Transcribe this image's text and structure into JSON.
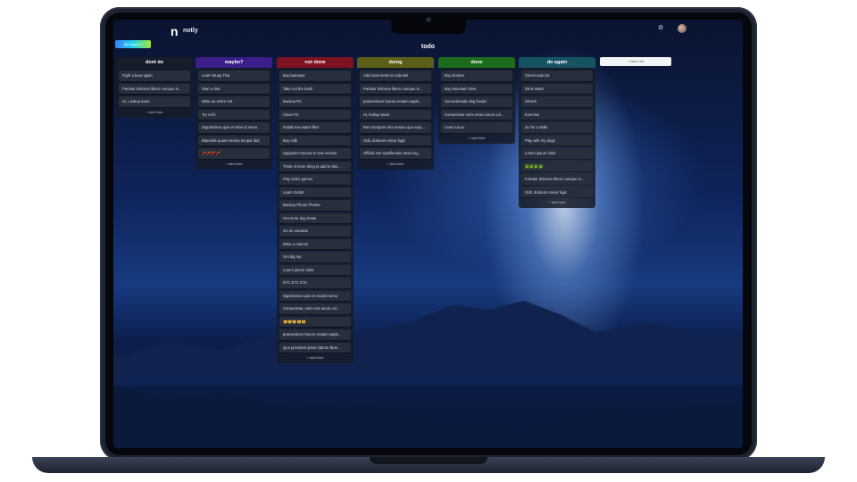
{
  "app": {
    "name": "notly",
    "logo": "n"
  },
  "header": {
    "settings_icon": "sliders-icon",
    "board_button": "My Board 1",
    "board_title": "todo"
  },
  "add_list_label": "+ Add List",
  "columns": [
    {
      "title": "dont do",
      "color": "#161c28",
      "cards": [
        "Fight a bear again",
        "Pariatur dolorum libero cumque is...",
        "Hi, Lookup team"
      ],
      "add_note": "+ Add Note"
    },
    {
      "title": "maybe?",
      "color": "#3b1e8a",
      "cards": [
        "Learn Muay Thai",
        "Start a diet",
        "Write an entire OS",
        "Try Arch",
        "Dignissimos quis et vitae id nemo",
        "Blanditiis quasi minima tempor ibid",
        "🧨🧨🧨🧨"
      ],
      "add_note": "+ Add Note"
    },
    {
      "title": "not done",
      "color": "#7d1220",
      "cards": [
        "Buy bananas",
        "Take out the trash",
        "Backup PC",
        "Clean PC",
        "Install new water filter",
        "Buy milk",
        "Upgrade Fusuma to new version",
        "Think of more thing to add to this ...",
        "Play video games",
        "Learn Godot",
        "Backup Phone Photos",
        "Get more dog treats",
        "Go on vacation",
        "Write a memoir",
        "Get dig ray",
        "Lorem ipsum dolor",
        "ETC ETC ETC",
        "Dignissimos quis et eiusrid nemo",
        "Consectetur, enim nos iurum col...",
        "😸😸😸😸😸",
        "praesentium harum veniam saple...",
        "Quo provident ipsum labore illum..."
      ],
      "add_note": "+ Add Note"
    },
    {
      "title": "doing",
      "color": "#5b5f18",
      "cards": [
        "Add more items to todo-list",
        "Pariatur dolorum libero cumque is...",
        "praesentium harum veniam saple...",
        "Hi, lookup team",
        "Rem tempore sint veniam quo repu...",
        "Odit, dolorum omnis fugit",
        "Officiis non repellendus amet ing..."
      ],
      "add_note": "+ Add Note"
    },
    {
      "title": "done",
      "color": "#1d6b1d",
      "cards": [
        "Buy Doritos",
        "Buy Mountain Dew",
        "Get automatic dog feeder",
        "Consectetur enim nemo iurum col...",
        "Learn Linux"
      ],
      "add_note": "+ Add Note"
    },
    {
      "title": "do again",
      "color": "#155363",
      "cards": [
        "Check todo list",
        "Drink water",
        "Stretch",
        "Exercise",
        "Go for a Walk",
        "Play with my dogs",
        "Lorem ipsum dolor",
        "🥦🥦🥦🥦",
        "Fortatur dolorum libero cumque is...",
        "Odit, dolorum omnis fugit"
      ],
      "add_note": "+ Add Note"
    }
  ]
}
